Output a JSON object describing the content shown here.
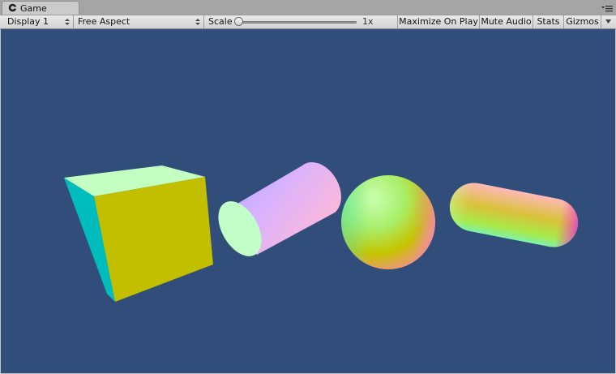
{
  "tab": {
    "title": "Game",
    "icon": "game-controller-icon"
  },
  "toolbar": {
    "display": "Display 1",
    "aspect": "Free Aspect",
    "scale_label": "Scale",
    "scale_value": "1x",
    "scale_slider_fraction": 0.0,
    "maximize_on_play": "Maximize On Play",
    "mute_audio": "Mute Audio",
    "stats": "Stats",
    "gizmos": "Gizmos"
  },
  "viewport": {
    "background_color": "#314d79",
    "objects": [
      "cube",
      "cylinder",
      "sphere",
      "capsule"
    ]
  },
  "colors": {
    "chrome": "#c2c2c2",
    "toolbar": "#dedede",
    "cube_front": "#c2be00",
    "cube_side": "#00bebe",
    "cube_top": "#c4ffc2"
  }
}
